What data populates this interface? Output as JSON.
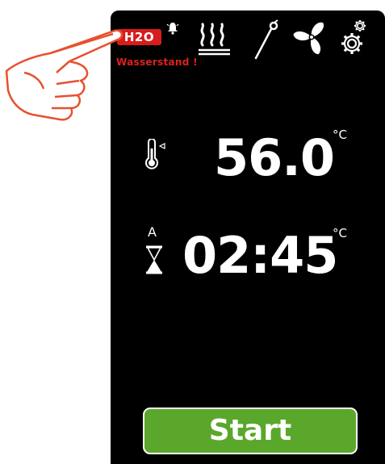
{
  "status_bar": {
    "water_badge": "H2O",
    "water_warning": "Wasserstand !",
    "icons": [
      "bell-icon",
      "heat-icon",
      "probe-icon",
      "fan-icon",
      "settings-icon"
    ]
  },
  "temperature": {
    "value": "56.0",
    "unit": "°C",
    "icon": "thermometer-icon"
  },
  "timer": {
    "mode": "A",
    "value": "02:45",
    "unit": "°C",
    "icon": "hourglass-icon"
  },
  "start_button": {
    "label": "Start"
  },
  "colors": {
    "panel": "#000000",
    "warning": "#e0201e",
    "start": "#5ba72b",
    "pointer_hand": "#e8502e"
  }
}
